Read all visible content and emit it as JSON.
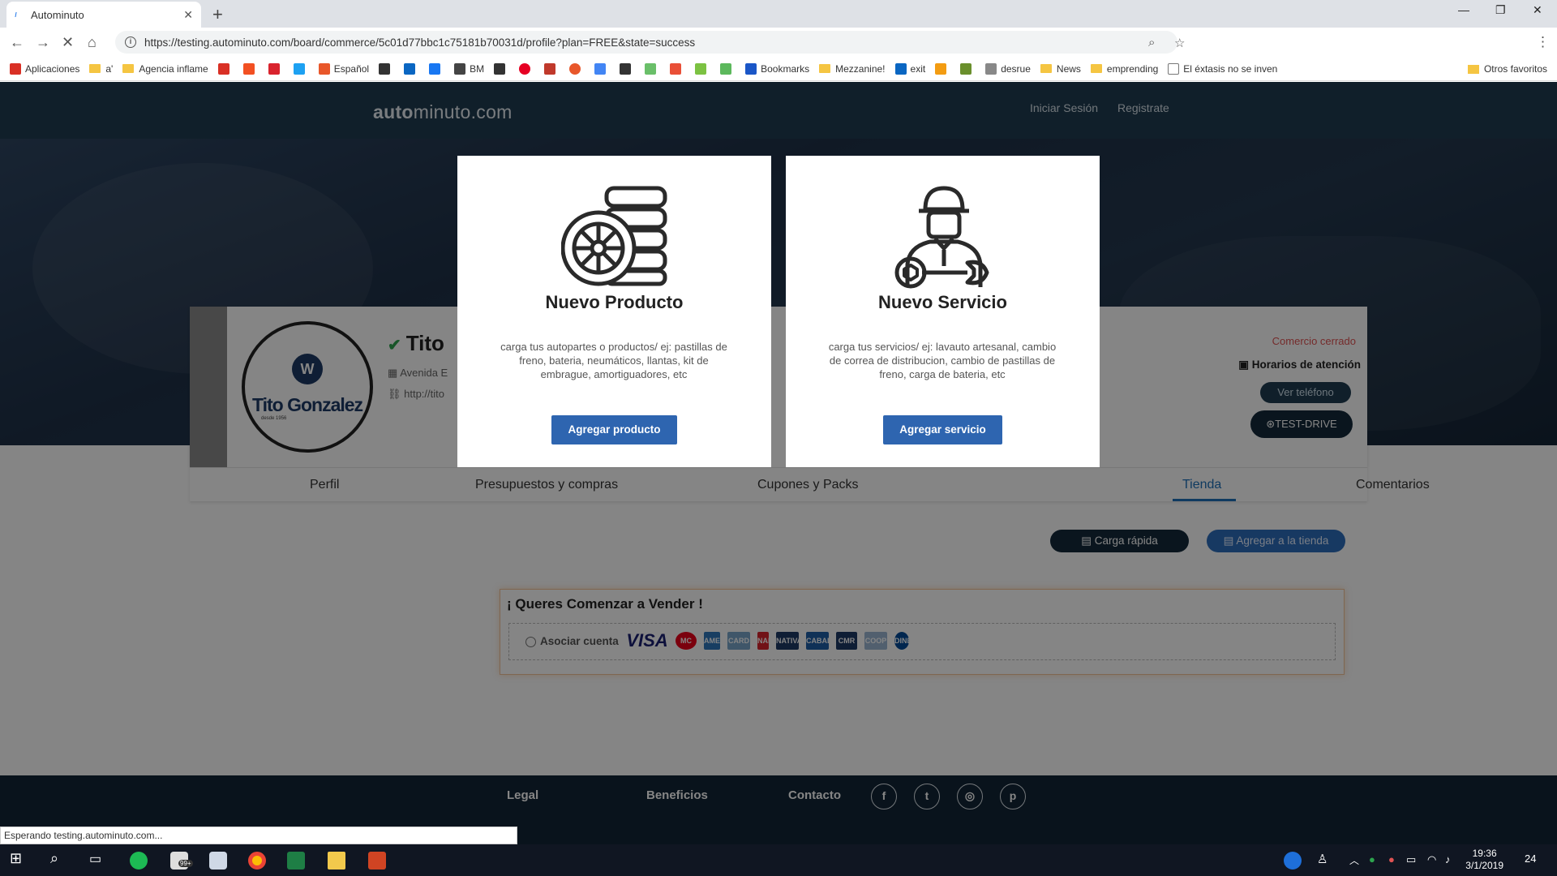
{
  "browser": {
    "tab_title": "Autominuto",
    "url": "https://testing.autominuto.com/board/commerce/5c01d77bbc1c75181b70031d/profile?plan=FREE&state=success",
    "bookmarks": [
      "Aplicaciones",
      "a'",
      "Agencia inflame",
      "Español",
      "BM",
      "Bookmarks",
      "Mezzanine!",
      "exit",
      "desrue",
      "News",
      "emprending",
      "El éxtasis no se inven"
    ],
    "other_bookmarks": "Otros favoritos",
    "status_text": "Esperando testing.autominuto.com..."
  },
  "header": {
    "logo_bold": "auto",
    "logo_rest": "minuto.com",
    "login": "Iniciar Sesión",
    "register": "Registrate"
  },
  "profile": {
    "brand": "Tito Gonzalez",
    "since": "desde 1956",
    "name": "Tito",
    "address": "Avenida E",
    "url": "http://tito",
    "status": "Comercio cerrado",
    "hours": "Horarios de atención",
    "phone_button": "Ver teléfono",
    "testdrive_button": "TEST-DRIVE"
  },
  "tabs": [
    "Perfil",
    "Presupuestos y compras",
    "Cupones y Packs",
    "Tienda",
    "Comentarios"
  ],
  "active_tab": "Tienda",
  "store": {
    "quick_load": "Carga rápida",
    "add_to_store": "Agregar a la tienda",
    "sell_title": "¡ Queres Comenzar a Vender !",
    "link_account": "Asociar cuenta"
  },
  "payment_logos": [
    "VISA",
    "MC",
    "AMEX",
    "CARD",
    "NAR",
    "NATIVA",
    "CABAL",
    "CMR",
    "COOP",
    "DINERS"
  ],
  "footer": {
    "legal": "Legal",
    "benefits": "Beneficios",
    "contact": "Contacto",
    "social": [
      "facebook",
      "twitter",
      "instagram",
      "pinterest"
    ]
  },
  "modal": {
    "product": {
      "title": "Nuevo Producto",
      "description": "carga tus autopartes o productos/ ej: pastillas de freno, bateria, neumáticos, llantas, kit de embrague, amortiguadores, etc",
      "button": "Agregar producto"
    },
    "service": {
      "title": "Nuevo Servicio",
      "description": "carga tus servicios/ ej: lavauto artesanal, cambio de correa de distribucion, cambio de pastillas de freno, carga de bateria, etc",
      "button": "Agregar servicio"
    }
  },
  "taskbar": {
    "time": "19:36",
    "date": "3/1/2019",
    "notifications": "24",
    "badge": "99+"
  },
  "colors": {
    "header": "#1f3d52",
    "primary_button": "#2e65b0",
    "active_tab": "#1d6fb8",
    "closed": "#e05353"
  }
}
